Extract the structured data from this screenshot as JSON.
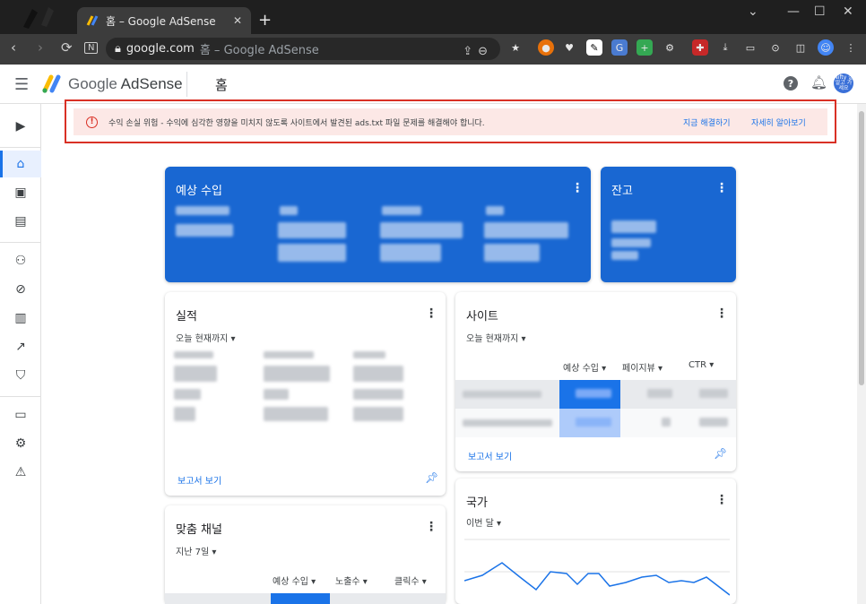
{
  "browser": {
    "tab_title": "홈 – Google AdSense",
    "tab_close": "✕",
    "new_tab": "+",
    "url_domain": "google.com",
    "url_rest": "홈 – Google AdSense",
    "window_minimize": "—",
    "window_maximize": "☐",
    "window_close": "✕"
  },
  "app": {
    "brand_google": "Google",
    "brand_adsense": "AdSense",
    "page_title": "홈",
    "avatar_text": "Nifty 잘 알고 가세요"
  },
  "alert": {
    "message": "수익 손실 위험 - 수익에 심각한 영향을 미치지 않도록 사이트에서 발견된 ads.txt 파일 문제를 해결해야 합니다.",
    "fix_now": "지금 해결하기",
    "learn_more": "자세히 알아보기"
  },
  "cards": {
    "estimated_earnings": {
      "title": "예상 수입"
    },
    "balance": {
      "title": "잔고"
    },
    "performance": {
      "title": "실적",
      "range": "오늘 현재까지 ▾",
      "report_link": "보고서 보기"
    },
    "sites": {
      "title": "사이트",
      "range": "오늘 현재까지 ▾",
      "columns": [
        "예상 수입 ▾",
        "페이지뷰 ▾",
        "CTR ▾"
      ],
      "report_link": "보고서 보기"
    },
    "custom_channels": {
      "title": "맞춤 채널",
      "range": "지난 7일 ▾",
      "columns": [
        "예상 수입 ▾",
        "노출수 ▾",
        "클릭수 ▾"
      ]
    },
    "countries": {
      "title": "국가",
      "range": "이번 달 ▾"
    }
  },
  "colors": {
    "accent": "#1a73e8",
    "card_blue": "#1967d2",
    "alert_bg": "#fce8e6",
    "alert_border": "#d93025"
  },
  "icons": {
    "sidebar": [
      "youtube-icon",
      "home-icon",
      "ads-icon",
      "sites-icon",
      "account-icon",
      "block-icon",
      "reports-icon",
      "optimization-icon",
      "policy-icon",
      "payments-icon",
      "settings-icon",
      "feedback-icon"
    ]
  }
}
